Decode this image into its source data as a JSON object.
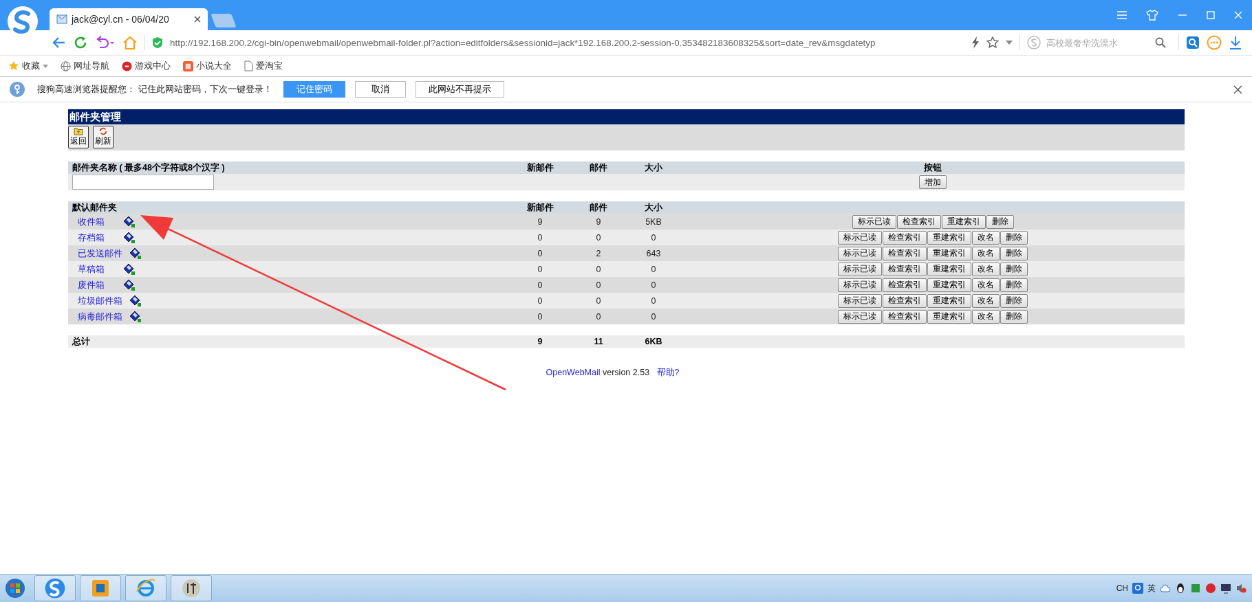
{
  "browser": {
    "tabs": [
      {
        "label": "jack@cyl.cn - 06/04/20",
        "selected": true
      }
    ],
    "address": "http://192.168.200.2/cgi-bin/openwebmail/openwebmail-folder.pl?action=editfolders&sessionid=jack*192.168.200.2-session-0.353482183608325&sort=date_rev&msgdatetyp",
    "search_placeholder": "高校最奢华洗澡水",
    "bookmarks": [
      "收藏",
      "网址导航",
      "游戏中心",
      "小说大全",
      "爱淘宝"
    ]
  },
  "infobar": {
    "message": "搜狗高速浏览器提醒您： 记住此网站密码，下次一键登录！",
    "buttons": [
      {
        "label": "记住密码",
        "primary": true
      },
      {
        "label": "取消",
        "primary": false
      },
      {
        "label": "此网站不再提示",
        "primary": false
      }
    ]
  },
  "page": {
    "title": "邮件夹管理",
    "toolbar": [
      "返回",
      "刷新"
    ],
    "new_folder": {
      "columns": [
        "邮件夹名称 ( 最多48个字符或8个汉字 )",
        "新邮件",
        "邮件",
        "大小",
        "按钮"
      ],
      "add_button": "增加"
    },
    "folders": {
      "columns": [
        "默认邮件夹",
        "新邮件",
        "邮件",
        "大小"
      ],
      "rows": [
        {
          "name": "收件箱",
          "new": "9",
          "mail": "9",
          "size": "5KB",
          "buttons": [
            "标示已读",
            "检查索引",
            "重建索引",
            "删除"
          ]
        },
        {
          "name": "存档箱",
          "new": "0",
          "mail": "0",
          "size": "0",
          "buttons": [
            "标示已读",
            "检查索引",
            "重建索引",
            "改名",
            "删除"
          ]
        },
        {
          "name": "已发送邮件",
          "new": "0",
          "mail": "2",
          "size": "643",
          "buttons": [
            "标示已读",
            "检查索引",
            "重建索引",
            "改名",
            "删除"
          ]
        },
        {
          "name": "草稿箱",
          "new": "0",
          "mail": "0",
          "size": "0",
          "buttons": [
            "标示已读",
            "检查索引",
            "重建索引",
            "改名",
            "删除"
          ]
        },
        {
          "name": "废件箱",
          "new": "0",
          "mail": "0",
          "size": "0",
          "buttons": [
            "标示已读",
            "检查索引",
            "重建索引",
            "改名",
            "删除"
          ]
        },
        {
          "name": "垃圾邮件箱",
          "new": "0",
          "mail": "0",
          "size": "0",
          "buttons": [
            "标示已读",
            "检查索引",
            "重建索引",
            "改名",
            "删除"
          ]
        },
        {
          "name": "病毒邮件箱",
          "new": "0",
          "mail": "0",
          "size": "0",
          "buttons": [
            "标示已读",
            "检查索引",
            "重建索引",
            "改名",
            "删除"
          ]
        }
      ],
      "total": {
        "label": "总计",
        "new": "9",
        "mail": "11",
        "size": "6KB"
      }
    },
    "footer": {
      "product": "OpenWebMail",
      "version": "version 2.53",
      "help": "帮助?"
    }
  },
  "taskbar": {
    "tray": [
      "CH",
      "英"
    ]
  }
}
